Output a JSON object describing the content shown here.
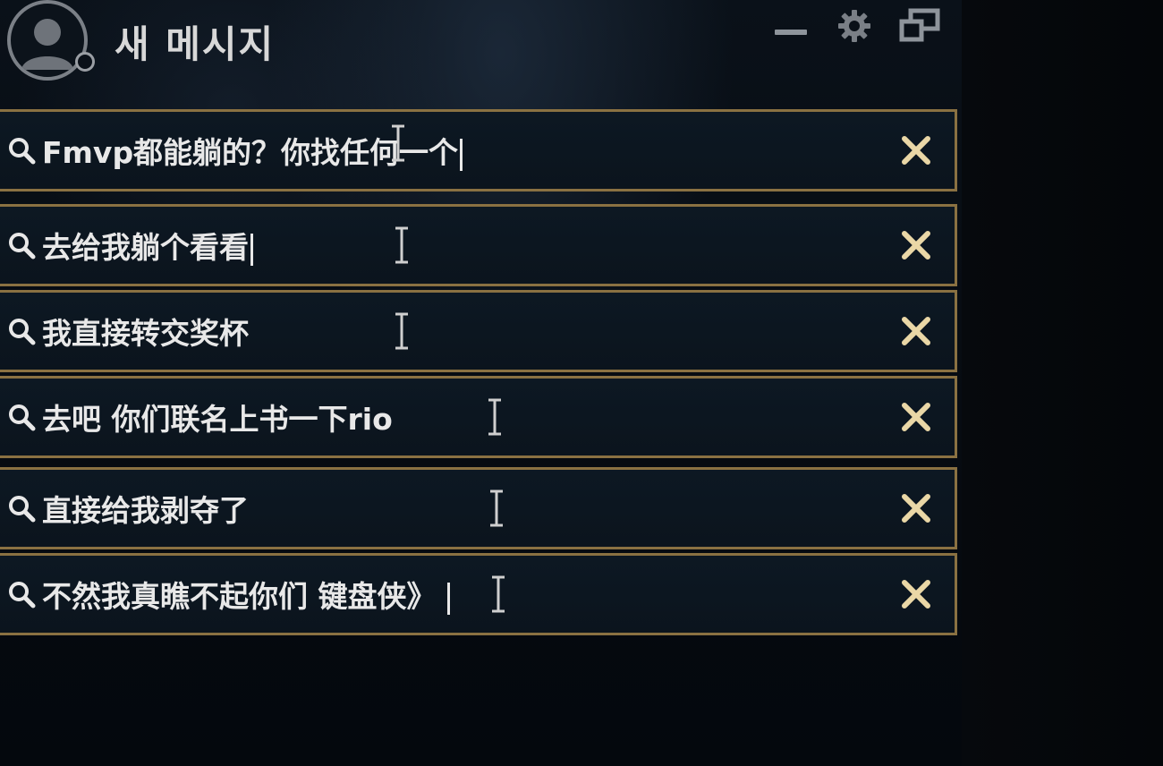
{
  "window": {
    "title": "새 메시지",
    "icons": {
      "avatar": "user-avatar-icon",
      "minimize": "minimize-icon",
      "settings": "gear-icon",
      "restore": "restore-window-icon"
    }
  },
  "colors": {
    "background": "#03070c",
    "row_background": "#0d1823",
    "row_border": "#8a7142",
    "close_x": "#ead7a6",
    "text": "#e8e8e8"
  },
  "messages": [
    {
      "text": "Fmvp都能躺的？你找任何一个",
      "has_caret": true
    },
    {
      "text": "去给我躺个看看",
      "has_caret": true
    },
    {
      "text": "我直接转交奖杯",
      "has_caret": false
    },
    {
      "text": "去吧 你们联名上书一下rio",
      "has_caret": false
    },
    {
      "text": "直接给我剥夺了",
      "has_caret": false
    },
    {
      "text": "不然我真瞧不起你们 键盘侠》",
      "has_caret": true
    }
  ]
}
